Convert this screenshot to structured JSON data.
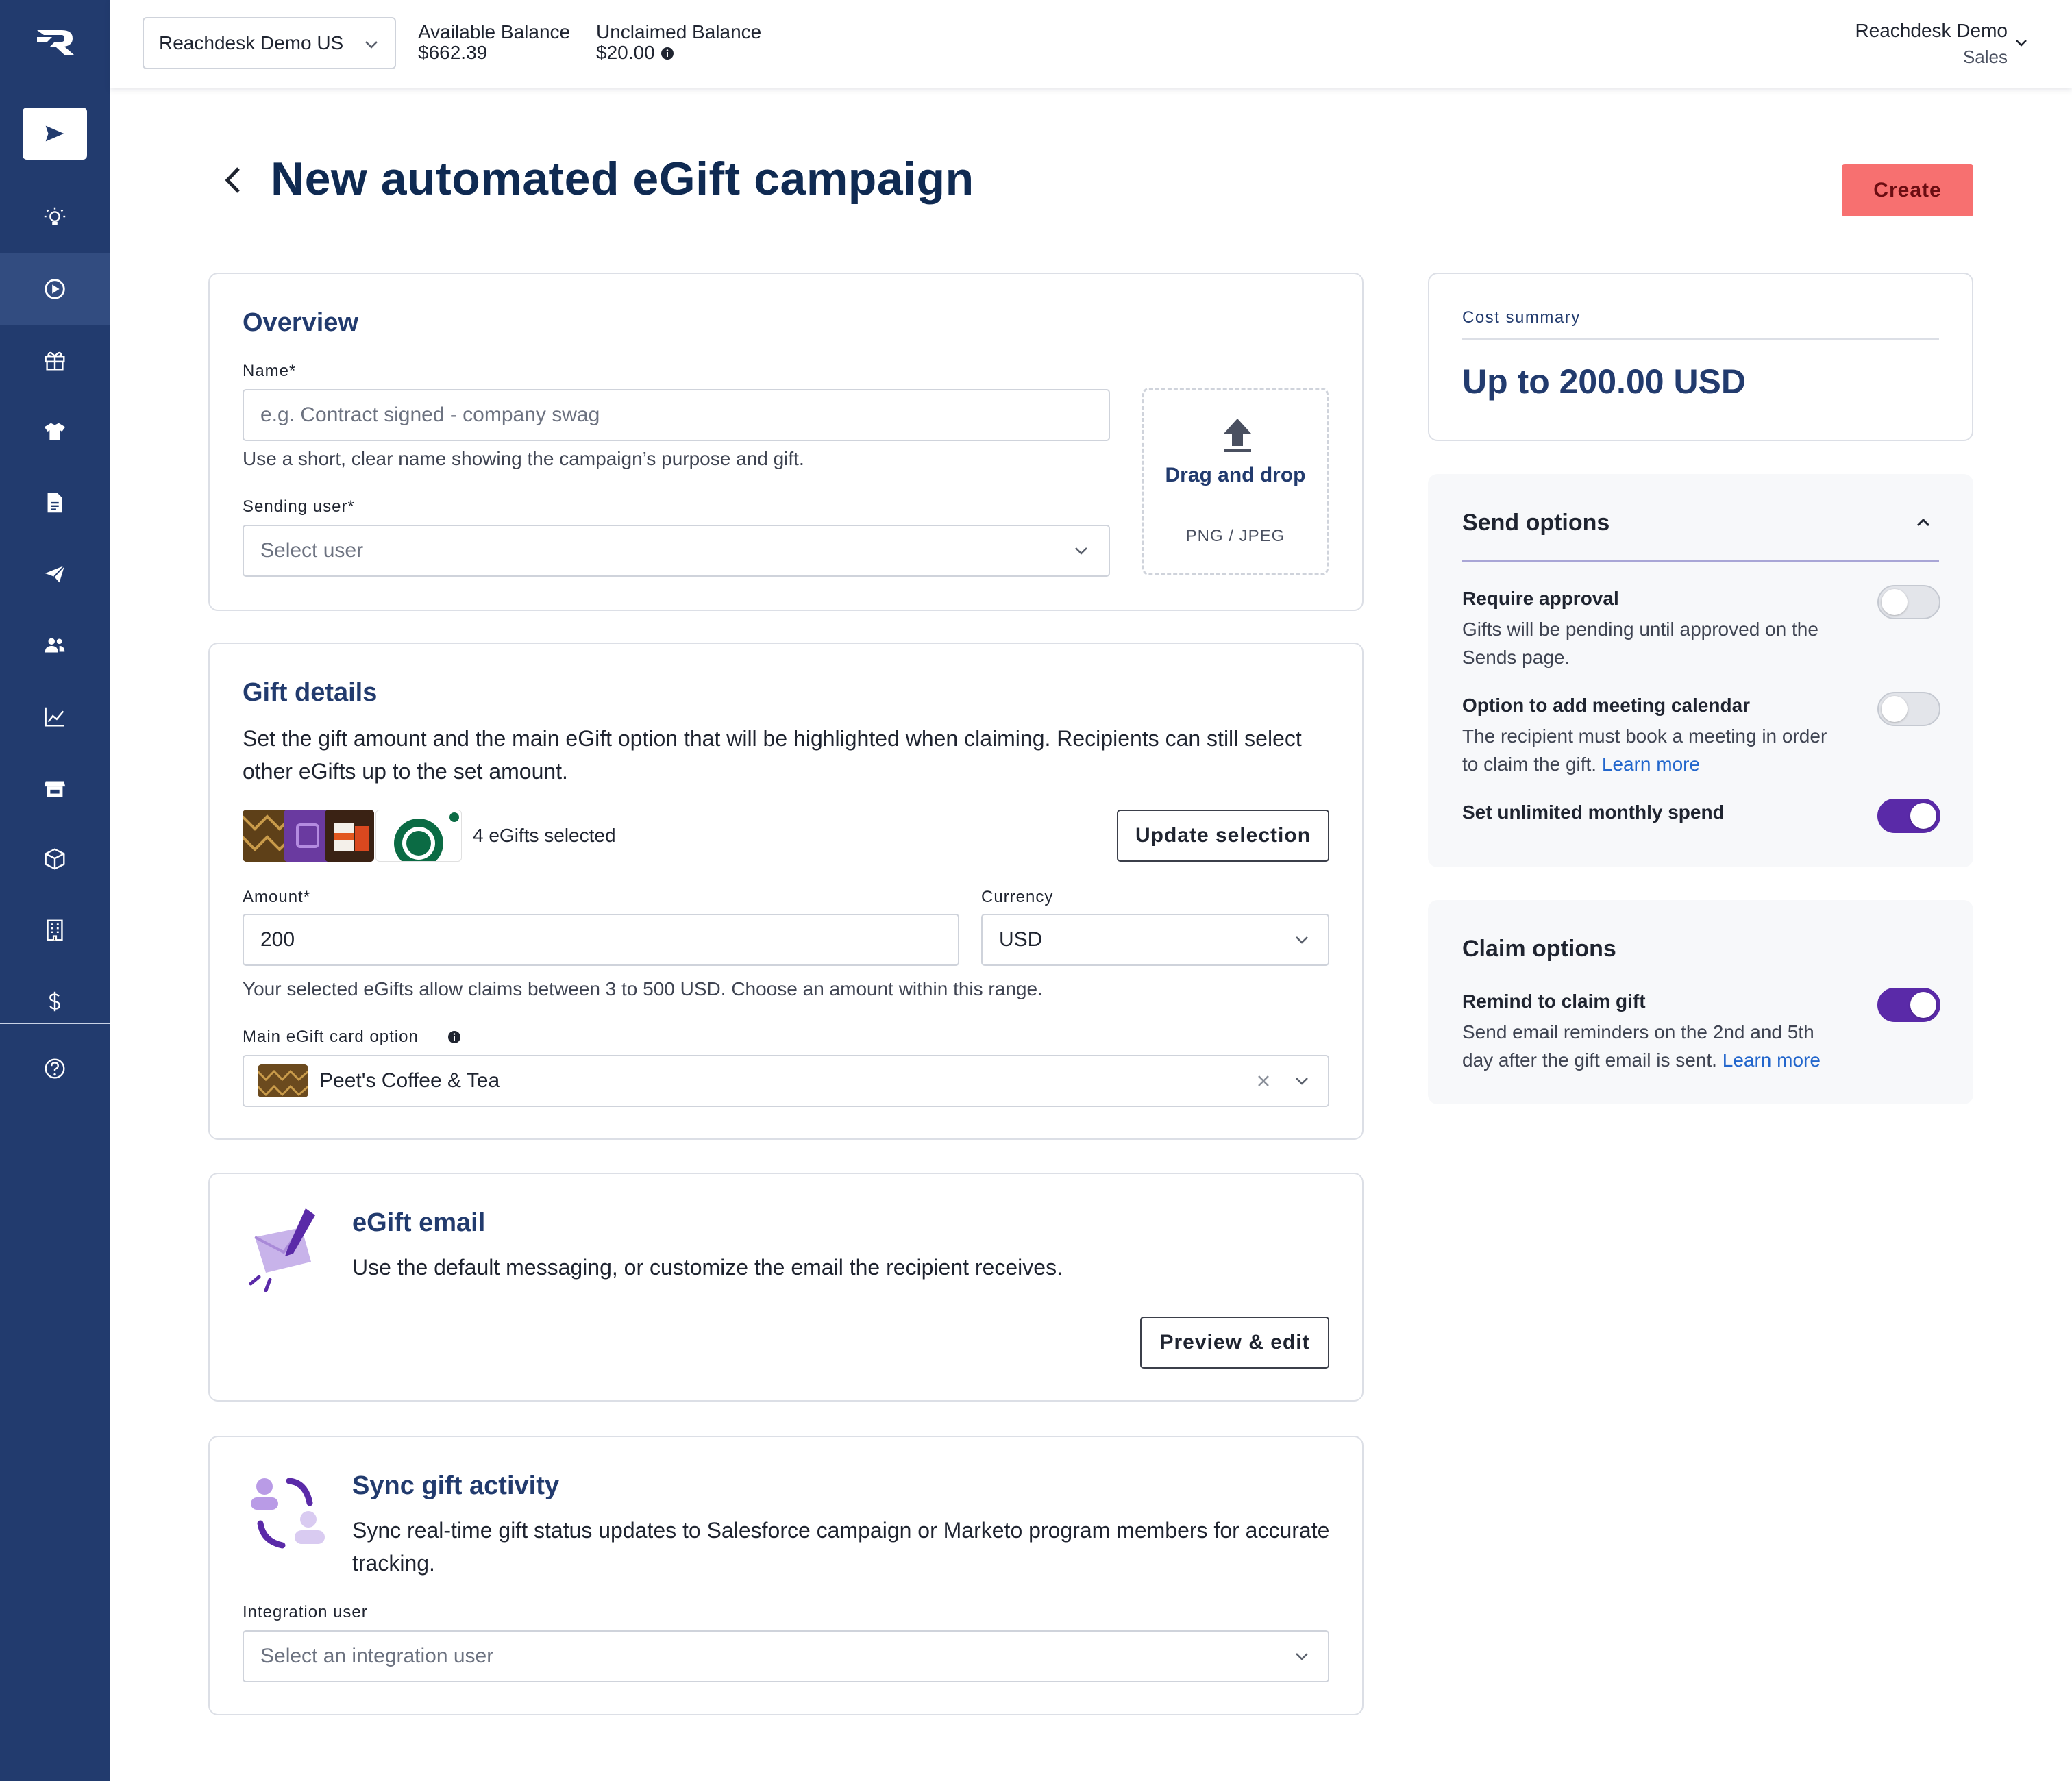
{
  "topbar": {
    "account": "Reachdesk Demo US",
    "available_label": "Available Balance",
    "available_value": "$662.39",
    "unclaimed_label": "Unclaimed Balance",
    "unclaimed_value": "$20.00",
    "user_name": "Reachdesk Demo",
    "user_role": "Sales"
  },
  "page": {
    "title": "New automated eGift campaign",
    "create_label": "Create"
  },
  "overview": {
    "heading": "Overview",
    "name_label": "Name*",
    "name_placeholder": "e.g. Contract signed - company swag",
    "name_help": "Use a short, clear name showing the campaign’s purpose and gift.",
    "sender_label": "Sending user*",
    "sender_placeholder": "Select user",
    "dropzone_title": "Drag and drop",
    "dropzone_sub": "PNG / JPEG"
  },
  "gift_details": {
    "heading": "Gift details",
    "description": "Set the gift amount and the main eGift option that will be highlighted when claiming. Recipients can still select other eGifts up to the set amount.",
    "selected_count": "4 eGifts selected",
    "update_label": "Update selection",
    "amount_label": "Amount*",
    "amount_value": "200",
    "currency_label": "Currency",
    "currency_value": "USD",
    "range_help": "Your selected eGifts allow claims between 3 to 500 USD. Choose an amount within this range.",
    "main_label": "Main eGift card option",
    "main_value": "Peet's Coffee & Tea"
  },
  "egift_email": {
    "heading": "eGift email",
    "description": "Use the default messaging, or customize the email the recipient receives.",
    "button": "Preview & edit"
  },
  "sync": {
    "heading": "Sync gift activity",
    "description": "Sync real-time gift status updates to Salesforce campaign or Marketo program members for accurate tracking.",
    "integration_label": "Integration user",
    "integration_placeholder": "Select an integration user"
  },
  "cost_summary": {
    "label": "Cost summary",
    "value": "Up to 200.00 USD"
  },
  "send_options": {
    "heading": "Send options",
    "items": [
      {
        "title": "Require approval",
        "desc": "Gifts will be pending until approved on the Sends page.",
        "enabled": false
      },
      {
        "title": "Option to add meeting calendar",
        "desc": "The recipient must book a meeting in order to claim the gift.",
        "link": "Learn more",
        "enabled": false
      },
      {
        "title": "Set unlimited monthly spend",
        "enabled": true
      }
    ]
  },
  "claim_options": {
    "heading": "Claim options",
    "items": [
      {
        "title": "Remind to claim gift",
        "desc": "Send email reminders on the 2nd and 5th day after the gift email is sent.",
        "link": "Learn more",
        "enabled": true
      }
    ]
  },
  "colors": {
    "sidebar": "#223b6e",
    "accent_purple": "#5a2aa8",
    "create_button": "#f77070",
    "heading_navy": "#0f2a52"
  },
  "icons": {
    "sidebar": [
      "send-icon",
      "lightbulb-icon",
      "play-circle-icon",
      "gift-icon",
      "tshirt-icon",
      "document-icon",
      "paper-plane-icon",
      "users-icon",
      "chart-icon",
      "store-icon",
      "box-icon",
      "building-icon",
      "dollar-icon",
      "help-icon"
    ]
  }
}
